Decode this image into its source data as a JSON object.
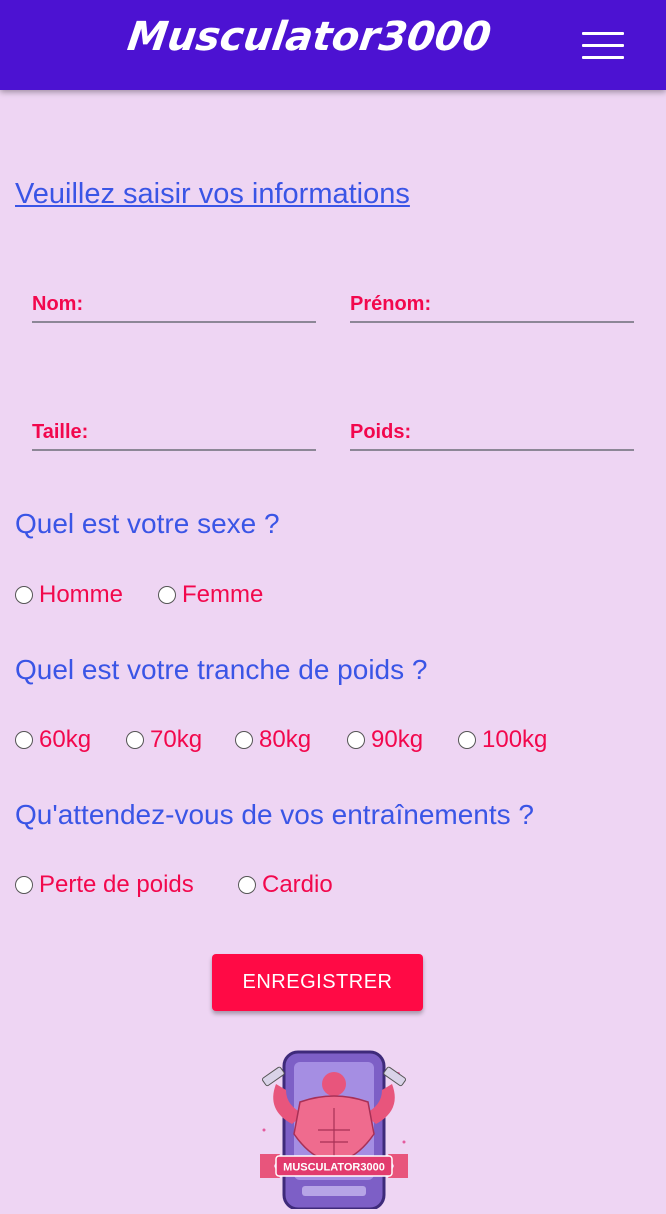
{
  "header": {
    "brand": "Musculator3000",
    "menu_icon": "hamburger-menu-icon"
  },
  "form": {
    "title": "Veuillez saisir vos informations",
    "fields": {
      "nom": "Nom:",
      "prenom": "Prénom:",
      "taille": "Taille:",
      "poids": "Poids:"
    },
    "q_sexe": "Quel est votre sexe ?",
    "sexe_options": [
      "Homme",
      "Femme"
    ],
    "q_poids": "Quel est votre tranche de poids ?",
    "poids_options": [
      "60kg",
      "70kg",
      "80kg",
      "90kg",
      "100kg"
    ],
    "q_objectif": "Qu'attendez-vous de vos entraînements ?",
    "objectif_options": [
      "Perte de poids",
      "Cardio"
    ],
    "submit_label": "ENREGISTRER"
  },
  "logo": {
    "text": "MUSCULATOR3000",
    "icon": "bodybuilder-logo-icon"
  },
  "colors": {
    "topbar": "#4c12d2",
    "background": "#eed5f3",
    "accent_blue": "#3a55e6",
    "accent_red": "#f2084d",
    "button": "#ff0a45"
  }
}
